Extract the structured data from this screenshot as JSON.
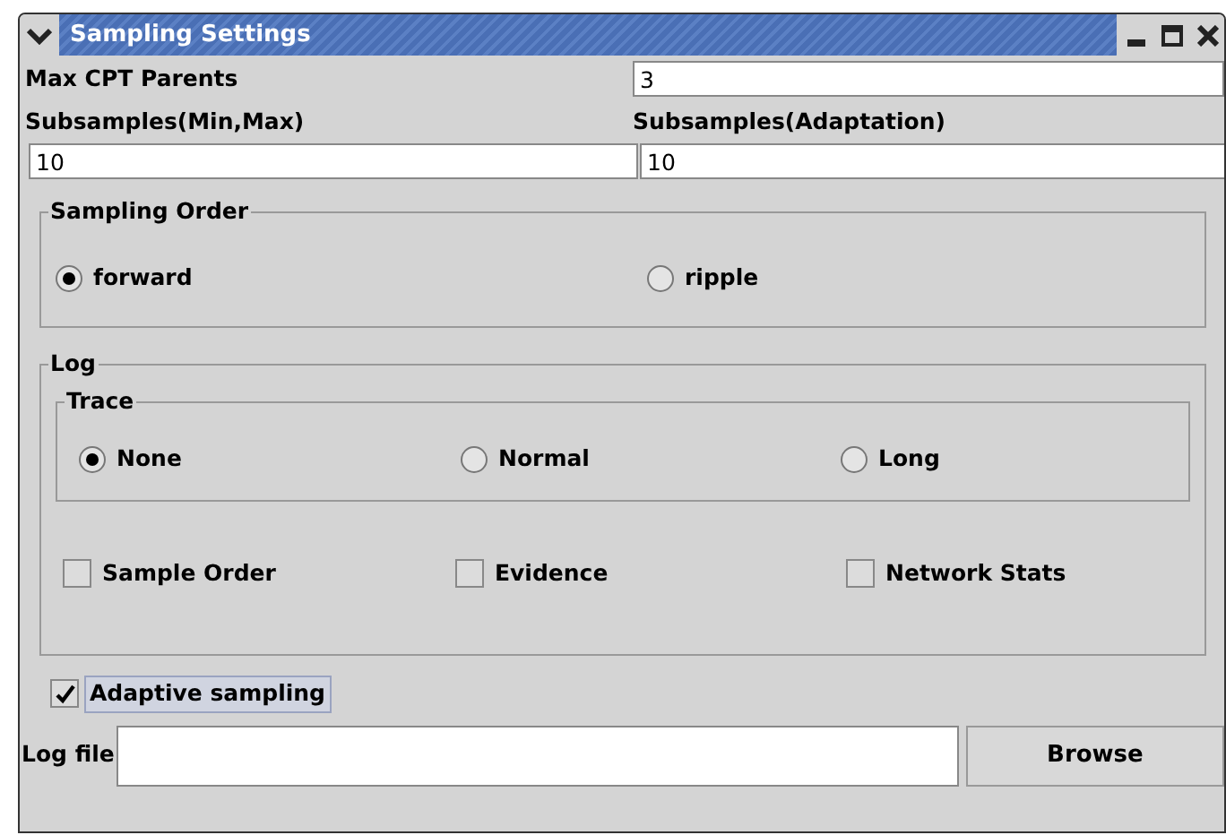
{
  "window": {
    "title": "Sampling Settings"
  },
  "max_cpt_parents": {
    "label": "Max CPT Parents",
    "value": "3"
  },
  "subsamples_min_max": {
    "label": "Subsamples(Min,Max)",
    "value": "10"
  },
  "subsamples_adaptation": {
    "label": "Subsamples(Adaptation)",
    "value": "10"
  },
  "sampling_order": {
    "title": "Sampling Order",
    "options": [
      {
        "label": "forward",
        "selected": true
      },
      {
        "label": "ripple",
        "selected": false
      }
    ]
  },
  "log": {
    "title": "Log",
    "trace": {
      "title": "Trace",
      "options": [
        {
          "label": "None",
          "selected": true
        },
        {
          "label": "Normal",
          "selected": false
        },
        {
          "label": "Long",
          "selected": false
        }
      ]
    },
    "checkboxes": [
      {
        "label": "Sample Order",
        "checked": false
      },
      {
        "label": "Evidence",
        "checked": false
      },
      {
        "label": "Network Stats",
        "checked": false
      }
    ]
  },
  "adaptive_sampling": {
    "label": "Adaptive sampling",
    "checked": true
  },
  "log_file": {
    "label": "Log file"
  },
  "browse_button": "Browse"
}
